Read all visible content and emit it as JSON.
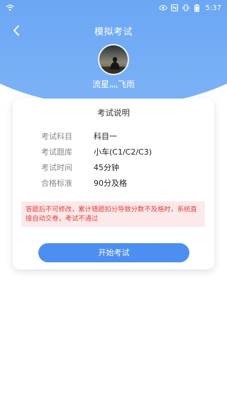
{
  "status_bar": {
    "time": "5:37",
    "signal_icon": "wifi-icon",
    "battery_icon": "battery-icon"
  },
  "header": {
    "title": "模拟考试",
    "back_icon": "chevron-left-icon"
  },
  "user": {
    "name": "流星灬飞雨"
  },
  "card": {
    "title": "考试说明",
    "rows": [
      {
        "label": "考试科目",
        "value": "科目一"
      },
      {
        "label": "考试题库",
        "value": "小车(C1/C2/C3)"
      },
      {
        "label": "考试时间",
        "value": "45分钟"
      },
      {
        "label": "合格标准",
        "value": "90分及格"
      }
    ],
    "warning": "答题后不可修改，累计错题扣分导致分数不及格时，系统直接自动交卷，考试不通过",
    "start_button": "开始考试"
  },
  "colors": {
    "primary": "#4d8ff0",
    "warning_text": "#e53d3d",
    "warning_bg": "#fde9e9"
  }
}
